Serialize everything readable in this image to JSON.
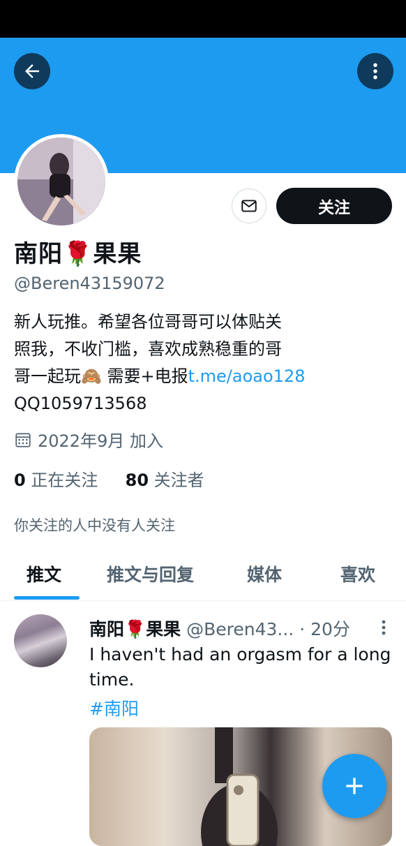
{
  "header": {
    "back_icon": "arrow-left-icon",
    "more_icon": "more-vertical-icon"
  },
  "profile": {
    "follow_label": "关注",
    "name_prefix": "南阳",
    "name_emoji": "🌹",
    "name_suffix": "果果",
    "handle": "@Beren43159072",
    "bio_line1": "新人玩推。希望各位哥哥可以体贴关",
    "bio_line2": "照我，不收门槛，喜欢成熟稳重的哥",
    "bio_line3_text": "哥一起玩🙈 需要+电报",
    "bio_link": "t.me/aoao128",
    "bio_line4": "QQ1059713568",
    "joined": "2022年9月 加入",
    "following_count": "0",
    "following_label": "正在关注",
    "followers_count": "80",
    "followers_label": "关注者",
    "followed_by_none": "你关注的人中没有人关注"
  },
  "tabs": [
    {
      "label": "推文",
      "active": true
    },
    {
      "label": "推文与回复",
      "active": false
    },
    {
      "label": "媒体",
      "active": false
    },
    {
      "label": "喜欢",
      "active": false
    }
  ],
  "tweet": {
    "name": "南阳🌹果果",
    "handle": "@Beren43...",
    "time": "· 20分",
    "text": "I haven't had an orgasm for a long time.",
    "hashtag": "#南阳"
  },
  "colors": {
    "accent": "#1d9bf0",
    "text": "#0f1419",
    "secondary": "#536471",
    "banner": "#1d9bf0"
  }
}
